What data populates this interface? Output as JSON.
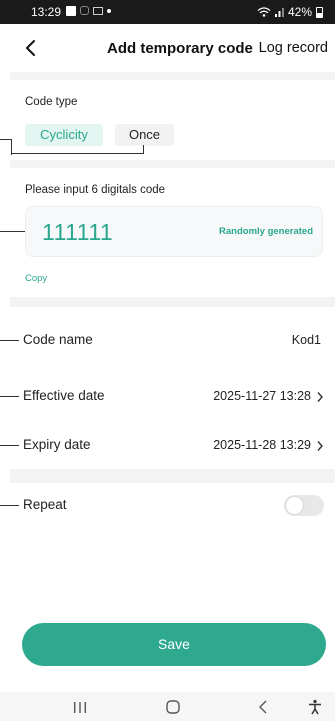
{
  "status_bar": {
    "time": "13:29",
    "battery": "42%"
  },
  "header": {
    "title": "Add temporary code",
    "log_record": "Log record"
  },
  "code_type": {
    "label": "Code type",
    "options": [
      "Cyclicity",
      "Once"
    ],
    "selected": "Cyclicity"
  },
  "code_input": {
    "label": "Please input 6 digitals code",
    "value": "111111",
    "random_label": "Randomly generated",
    "copy_label": "Copy"
  },
  "rows": {
    "code_name": {
      "label": "Code name",
      "value": "Kod1"
    },
    "effective_date": {
      "label": "Effective date",
      "value": "2025-11-27 13:28"
    },
    "expiry_date": {
      "label": "Expiry date",
      "value": "2025-11-28 13:29"
    },
    "repeat": {
      "label": "Repeat",
      "enabled": false
    }
  },
  "save_label": "Save",
  "colors": {
    "accent": "#2fa98e",
    "accent_text": "#2aa78e",
    "chip_bg": "#e3f5f0",
    "separator": "#f3f3f3"
  },
  "icons": [
    "gallery-icon",
    "instagram-icon",
    "mail-icon",
    "wifi-icon",
    "signal-icon",
    "battery-icon",
    "back-arrow-icon",
    "chevron-right-icon",
    "recent-apps-icon",
    "home-icon",
    "nav-back-icon",
    "accessibility-icon"
  ]
}
